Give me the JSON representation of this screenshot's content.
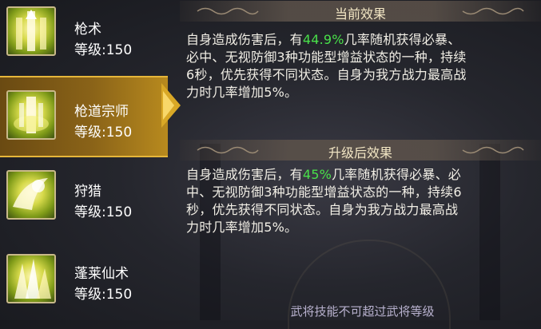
{
  "skills": [
    {
      "name": "枪术",
      "level": "等级:150",
      "icon": "spear-art-icon",
      "selected": false
    },
    {
      "name": "枪道宗师",
      "level": "等级:150",
      "icon": "spear-master-icon",
      "selected": true
    },
    {
      "name": "狩猎",
      "level": "等级:150",
      "icon": "hunting-icon",
      "selected": false
    },
    {
      "name": "蓬莱仙术",
      "level": "等级:150",
      "icon": "penglai-immortal-art-icon",
      "selected": false
    }
  ],
  "current_effect": {
    "title": "当前效果",
    "line1_pre": "自身造成伤害后，有",
    "line1_value": "44.9%",
    "line1_post": "几率随机获得必暴、",
    "line2": "必中、无视防御3种功能型增益状态的一种，持续",
    "line3": "6秒，优先获得不同状态。自身为我方战力最高战",
    "line4": "力时几率增加5%。"
  },
  "upgrade_effect": {
    "title": "升级后效果",
    "line1_pre": "自身造成伤害后，有",
    "line1_value": "45%",
    "line1_post": "几率随机获得必暴、必",
    "line2": "中、无视防御3种功能型增益状态的一种，持续6",
    "line3": "秒，优先获得不同状态。自身为我方战力最高战",
    "line4": "力时几率增加5%。"
  },
  "footer_note": "武将技能不可超过武将等级",
  "colors": {
    "highlight": "#49e04a",
    "selected_bg": "#8a6318",
    "accent_gold": "#e6b63a"
  }
}
